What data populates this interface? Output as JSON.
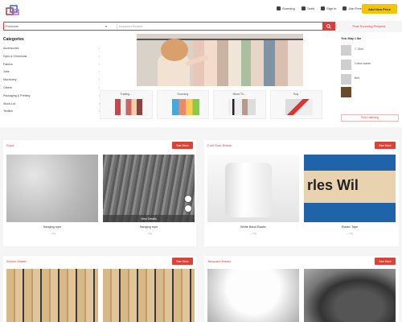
{
  "header": {
    "links": [
      {
        "label": "Sourcing",
        "icon": "search-icon"
      },
      {
        "label": "Tools",
        "icon": "tools-icon"
      },
      {
        "label": "Sign in",
        "icon": "user-icon"
      },
      {
        "label": "Join Free",
        "icon": "user-plus-icon"
      }
    ],
    "add_button": "Add New Price"
  },
  "search": {
    "category": "Products",
    "placeholder": "Keyword Search",
    "button_icon": "search-icon"
  },
  "quote_link": "Post Sourcing Request",
  "categories": {
    "title": "Categories",
    "items": [
      "Accessories",
      "Dyes & Chemicals",
      "Fabrics",
      "Jobs",
      "Machinery",
      "Others",
      "Packaging & Printing",
      "Stock Lot",
      "Textiles"
    ]
  },
  "tiles": [
    {
      "label": "Trading..."
    },
    {
      "label": "Sourcing"
    },
    {
      "label": "Need Th..."
    },
    {
      "label": "Buy"
    }
  ],
  "you_may_like": {
    "title": "You May Like",
    "items": [
      {
        "text": "T- Shirt"
      },
      {
        "text": "Cotton waste"
      },
      {
        "text": "Belt"
      },
      {
        "text": ""
      }
    ],
    "view_more": "Post Listening"
  },
  "sections": [
    {
      "title": "Rope",
      "see_more": "See More",
      "products": [
        {
          "name": "Hanging rope",
          "price": "-- / Kg"
        },
        {
          "name": "Hanging rope",
          "price": "-- / Kg",
          "hover_label": "View Details"
        }
      ]
    },
    {
      "title": "Fold Over Elastic",
      "see_more": "See More",
      "products": [
        {
          "name": "White Band Elastic",
          "price": "-- / Kg"
        },
        {
          "name": "Elastic Tape",
          "price": "-- / Kg",
          "image_text": "rles Wil"
        }
      ]
    },
    {
      "title": "Woven Elastic",
      "see_more": "See More"
    },
    {
      "title": "Jacquard Elastic",
      "see_more": "See More"
    }
  ],
  "colors": {
    "accent": "#e03a3a",
    "cta": "#f5c400"
  }
}
